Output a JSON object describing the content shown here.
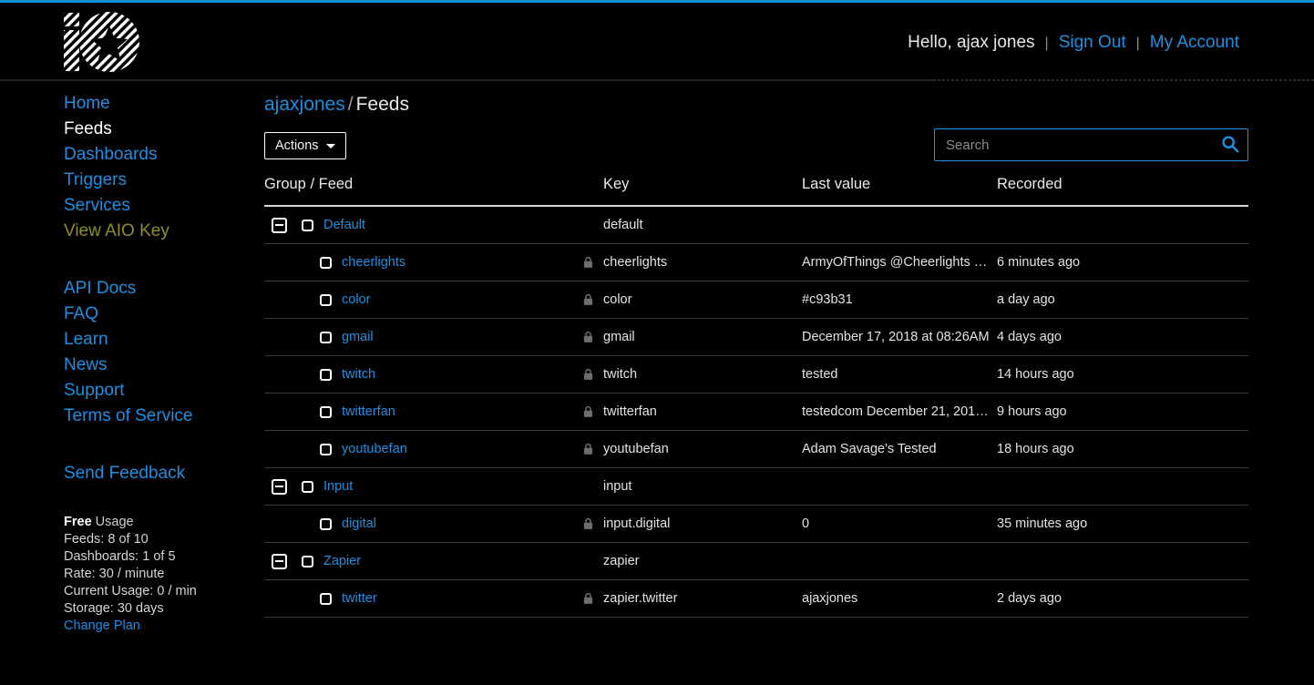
{
  "header": {
    "logo_alt": "adafruit-io-logo",
    "greeting": "Hello, ajax jones",
    "separator": "|",
    "sign_out": "Sign Out",
    "my_account": "My Account"
  },
  "sidebar": {
    "primary": [
      {
        "label": "Home",
        "style": "link"
      },
      {
        "label": "Feeds",
        "style": "active"
      },
      {
        "label": "Dashboards",
        "style": "link"
      },
      {
        "label": "Triggers",
        "style": "link"
      },
      {
        "label": "Services",
        "style": "link"
      },
      {
        "label": "View AIO Key",
        "style": "key"
      }
    ],
    "secondary": [
      {
        "label": "API Docs",
        "style": "link"
      },
      {
        "label": "FAQ",
        "style": "link"
      },
      {
        "label": "Learn",
        "style": "link"
      },
      {
        "label": "News",
        "style": "link"
      },
      {
        "label": "Support",
        "style": "link"
      },
      {
        "label": "Terms of Service",
        "style": "link"
      }
    ],
    "feedback": {
      "label": "Send Feedback"
    },
    "usage": {
      "plan": "Free",
      "plan_suffix": " Usage",
      "feeds": "Feeds: 8 of 10",
      "dashboards": "Dashboards: 1 of 5",
      "rate": "Rate: 30 / minute",
      "current_usage": "Current Usage: 0 / min",
      "storage": "Storage: 30 days",
      "change_plan": "Change Plan"
    }
  },
  "main": {
    "breadcrumb": {
      "user": "ajaxjones",
      "separator": "/",
      "page": "Feeds"
    },
    "actions_button": "Actions",
    "search": {
      "value": "",
      "placeholder": "Search"
    },
    "table": {
      "headers": [
        "Group / Feed",
        "Key",
        "Last value",
        "Recorded"
      ],
      "rows": [
        {
          "type": "group",
          "name": "Default",
          "key": "default",
          "value": "",
          "recorded": "",
          "locked": false
        },
        {
          "type": "feed",
          "name": "cheerlights",
          "key": "cheerlights",
          "value": "ArmyOfThings @Cheerlights …",
          "recorded": "6 minutes ago",
          "locked": true
        },
        {
          "type": "feed",
          "name": "color",
          "key": "color",
          "value": "#c93b31",
          "recorded": "a day ago",
          "locked": true
        },
        {
          "type": "feed",
          "name": "gmail",
          "key": "gmail",
          "value": "December 17, 2018 at 08:26AM",
          "recorded": "4 days ago",
          "locked": true
        },
        {
          "type": "feed",
          "name": "twitch",
          "key": "twitch",
          "value": "tested",
          "recorded": "14 hours ago",
          "locked": true
        },
        {
          "type": "feed",
          "name": "twitterfan",
          "key": "twitterfan",
          "value": "testedcom December 21, 201…",
          "recorded": "9 hours ago",
          "locked": true
        },
        {
          "type": "feed",
          "name": "youtubefan",
          "key": "youtubefan",
          "value": "Adam Savage's Tested",
          "recorded": "18 hours ago",
          "locked": true
        },
        {
          "type": "group",
          "name": "Input",
          "key": "input",
          "value": "",
          "recorded": "",
          "locked": false
        },
        {
          "type": "feed",
          "name": "digital",
          "key": "input.digital",
          "value": "0",
          "recorded": "35 minutes ago",
          "locked": true
        },
        {
          "type": "group",
          "name": "Zapier",
          "key": "zapier",
          "value": "",
          "recorded": "",
          "locked": false
        },
        {
          "type": "feed",
          "name": "twitter",
          "key": "zapier.twitter",
          "value": "ajaxjones",
          "recorded": "2 days ago",
          "locked": true
        }
      ]
    }
  },
  "icons": {
    "search": "search-icon",
    "lock": "lock-icon",
    "collapse": "collapse-icon",
    "caret": "chevron-down-icon"
  },
  "colors": {
    "background": "#000000",
    "accent_blue": "#1e8fe1",
    "top_rule": "#0e90d2",
    "key_yellow": "#8f8f25",
    "text": "#e3e3e3",
    "divider": "#3a3a3a"
  }
}
